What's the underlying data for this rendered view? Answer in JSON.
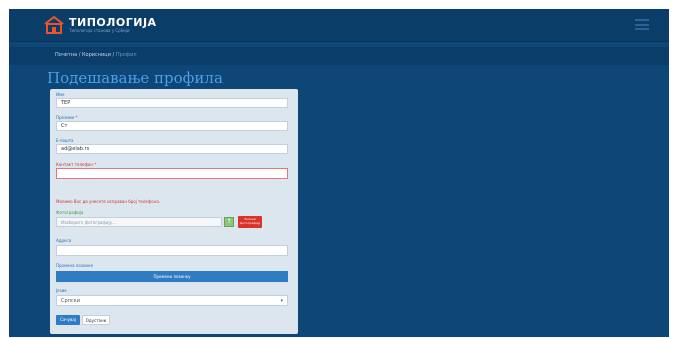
{
  "app": {
    "logo_title": "ТИПОЛОГИЈА",
    "logo_subtitle": "Типологија станова у Србији"
  },
  "breadcrumb": {
    "items": [
      "Почетна",
      "Корисници"
    ],
    "separator": "/",
    "current": "Профил"
  },
  "page_title": "Подешавање профила",
  "form": {
    "first_name": {
      "label": "Име",
      "value": "TEP"
    },
    "last_name": {
      "label": "Презиме",
      "value": "Ст"
    },
    "email": {
      "label": "Е-пошта",
      "value": "ad@elab.rs"
    },
    "phone": {
      "label": "Контакт телефон",
      "value": "",
      "error": "Молимо Вас да унесете исправан број телефона."
    },
    "photo": {
      "label": "Фотографија",
      "placeholder": "Изаберите фотографију...",
      "upload_icon": "upload-icon",
      "delete_label": "Уклони фотографију"
    },
    "address": {
      "label": "Адреса",
      "value": ""
    },
    "password": {
      "label": "Промена лозинке",
      "button_label": "Промени лозинку"
    },
    "language": {
      "label": "Језик",
      "selected": "Српски"
    },
    "save_label": "Сачувај",
    "back_label": "Одустани"
  },
  "colors": {
    "background": "#0e4677",
    "accent": "#2f7bc4",
    "title": "#4aa0e8",
    "danger": "#d9342b",
    "success": "#8fc47a"
  }
}
